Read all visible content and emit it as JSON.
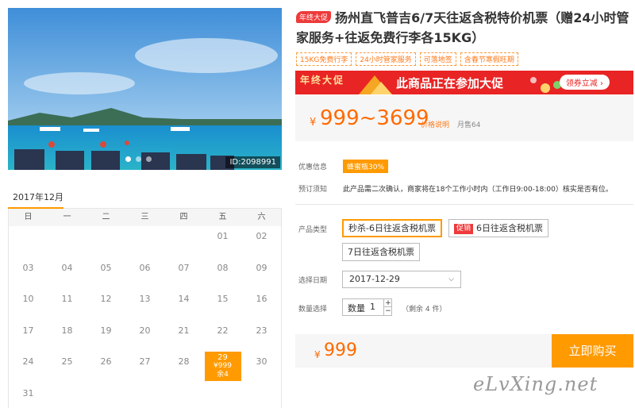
{
  "photo": {
    "id_label": "ID:2098991"
  },
  "calendar": {
    "month_label": "2017年12月",
    "weekdays": [
      "日",
      "一",
      "二",
      "三",
      "四",
      "五",
      "六"
    ],
    "days": [
      "01",
      "02",
      "03",
      "04",
      "05",
      "06",
      "07",
      "08",
      "09",
      "10",
      "11",
      "12",
      "13",
      "14",
      "15",
      "16",
      "17",
      "18",
      "19",
      "20",
      "21",
      "22",
      "23",
      "24",
      "25",
      "26",
      "27",
      "28",
      "29",
      "30",
      "31"
    ],
    "selected": {
      "day": "29",
      "price": "¥999",
      "stock": "余4"
    }
  },
  "product": {
    "hot_badge": "年终大促",
    "title": "扬州直飞普吉6/7天往返含税特价机票（赠24小时管家服务+往返免费行李各15KG）",
    "tags": [
      "15KG免费行李",
      "24小时管家服务",
      "可落地签",
      "含春节寒假旺期"
    ]
  },
  "banner": {
    "seal": "年终大促",
    "text": "此商品正在参加大促",
    "button": "领券立减 ›"
  },
  "price": {
    "currency": "¥",
    "range": "999~3699",
    "explain": "价格说明",
    "sold": "月售64"
  },
  "info": {
    "discount_label": "优惠信息",
    "discount_badge": "蜂蜜瓶30%",
    "booking_label": "预订须知",
    "booking_text": "此产品需二次确认，商家将在18个工作小时内（工作日9:00-18:00）核实是否有位。"
  },
  "options": {
    "type_label": "产品类型",
    "types": [
      {
        "label": "秒杀-6日往返含税机票",
        "promo": ""
      },
      {
        "label": "6日往返含税机票",
        "promo": "促销"
      },
      {
        "label": "7日往返含税机票",
        "promo": ""
      }
    ],
    "date_label": "选择日期",
    "date_value": "2017-12-29",
    "qty_label": "数量选择",
    "qty_inner_label": "数量",
    "qty_value": "1",
    "qty_plus": "+",
    "qty_minus": "−",
    "remain": "（剩余 4 件）"
  },
  "footer": {
    "currency": "¥",
    "price": "999",
    "buy_label": "立即购买"
  },
  "watermark": "eLvXing.net",
  "colors": {
    "accent": "#ff9a00",
    "price": "#ff6a00",
    "banner": "#e92424"
  }
}
